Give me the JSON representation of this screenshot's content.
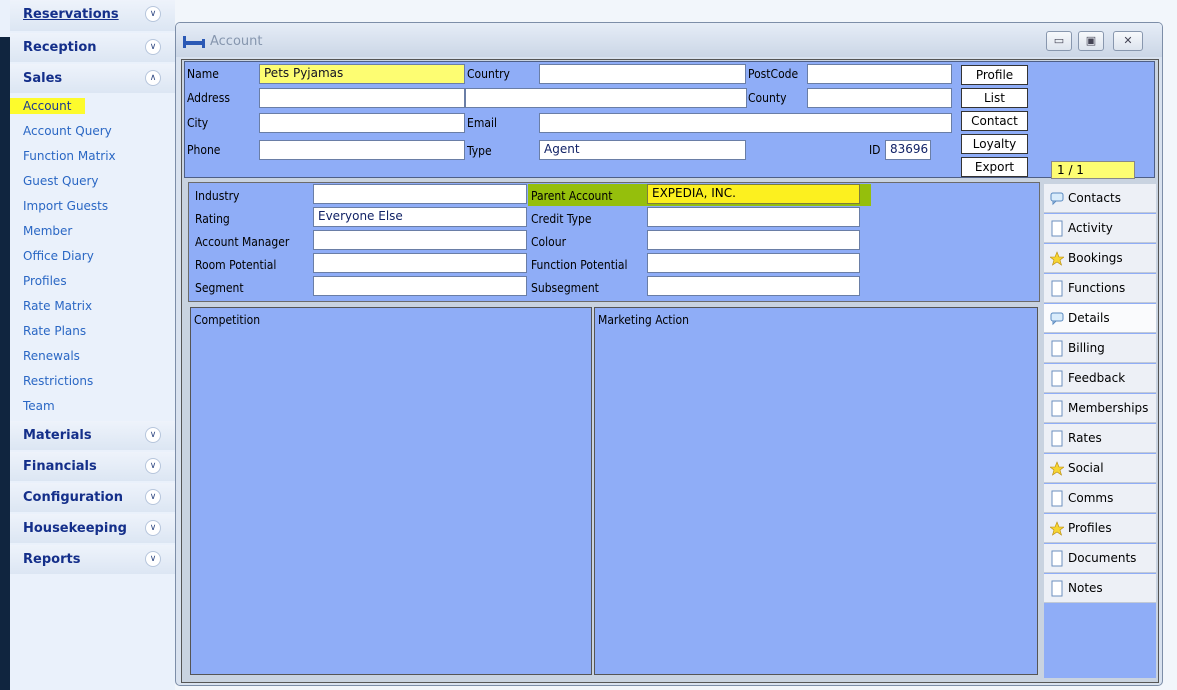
{
  "nav": {
    "sections": [
      {
        "label": "Reservations",
        "expanded": false
      },
      {
        "label": "Reception",
        "expanded": false
      },
      {
        "label": "Sales",
        "expanded": true
      },
      {
        "label": "Materials",
        "expanded": false
      },
      {
        "label": "Financials",
        "expanded": false
      },
      {
        "label": "Configuration",
        "expanded": false
      },
      {
        "label": "Housekeeping",
        "expanded": false
      },
      {
        "label": "Reports",
        "expanded": false
      }
    ],
    "sales_items": [
      "Account",
      "Account Query",
      "Function Matrix",
      "Guest Query",
      "Import Guests",
      "Member",
      "Office Diary",
      "Profiles",
      "Rate Matrix",
      "Rate Plans",
      "Renewals",
      "Restrictions",
      "Team"
    ],
    "active_item": "Account"
  },
  "window": {
    "title": "Account"
  },
  "header": {
    "name_label": "Name",
    "name_value": "Pets Pyjamas",
    "country_label": "Country",
    "country_value": "",
    "postcode_label": "PostCode",
    "postcode_value": "",
    "address_label": "Address",
    "address_value": "",
    "address_value2": "",
    "county_label": "County",
    "county_value": "",
    "city_label": "City",
    "city_value": "",
    "email_label": "Email",
    "email_value": "",
    "phone_label": "Phone",
    "phone_value": "",
    "type_label": "Type",
    "type_value": "Agent",
    "id_label": "ID",
    "id_value": "83696",
    "buttons": [
      "Profile",
      "List",
      "Contact",
      "Loyalty",
      "Export"
    ],
    "pager": "1 / 1"
  },
  "details": {
    "industry_label": "Industry",
    "industry_value": "",
    "rating_label": "Rating",
    "rating_value": "Everyone Else",
    "manager_label": "Account  Manager",
    "manager_value": "",
    "room_label": "Room Potential",
    "room_value": "",
    "segment_label": "Segment",
    "segment_value": "",
    "parent_label": "Parent Account",
    "parent_value": "EXPEDIA, INC.",
    "credit_label": "Credit Type",
    "credit_value": "",
    "colour_label": "Colour",
    "colour_value": "",
    "function_label": "Function Potential",
    "function_value": "",
    "subsegment_label": "Subsegment",
    "subsegment_value": ""
  },
  "memos": {
    "competition_label": "Competition",
    "marketing_label": "Marketing Action"
  },
  "tabs": [
    {
      "label": "Contacts",
      "icon": "speech-bubble-icon"
    },
    {
      "label": "Activity",
      "icon": "page-icon"
    },
    {
      "label": "Bookings",
      "icon": "star-icon"
    },
    {
      "label": "Functions",
      "icon": "page-icon"
    },
    {
      "label": "Details",
      "icon": "speech-bubble-icon",
      "selected": true
    },
    {
      "label": "Billing",
      "icon": "page-icon"
    },
    {
      "label": "Feedback",
      "icon": "page-icon"
    },
    {
      "label": "Memberships",
      "icon": "page-icon"
    },
    {
      "label": "Rates",
      "icon": "page-icon"
    },
    {
      "label": "Social",
      "icon": "star-icon"
    },
    {
      "label": "Comms",
      "icon": "page-icon"
    },
    {
      "label": "Profiles",
      "icon": "star-icon"
    },
    {
      "label": "Documents",
      "icon": "page-icon"
    },
    {
      "label": "Notes",
      "icon": "page-icon"
    }
  ],
  "colors": {
    "panel": "#8fadf7",
    "highlight_yellow": "#fdfd72",
    "parent_green": "#95bf0c",
    "nav_active": "#fdfb2c"
  }
}
